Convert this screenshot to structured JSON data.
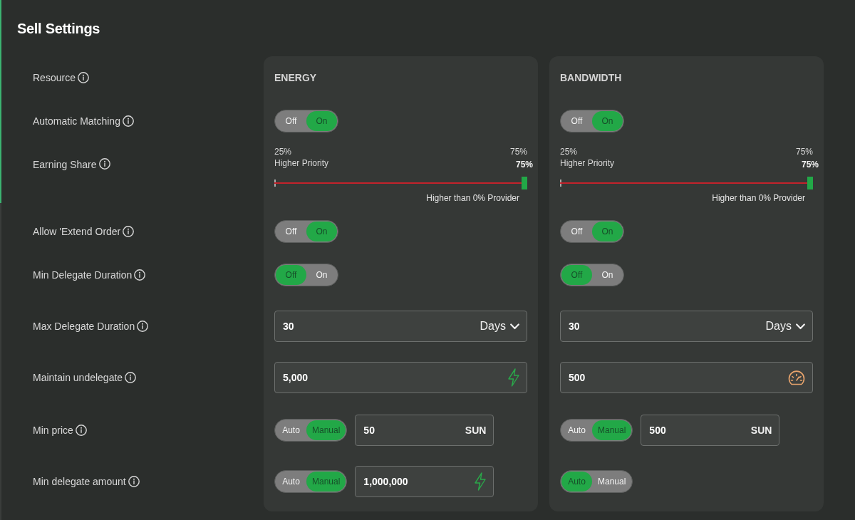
{
  "title": "Sell Settings",
  "setting_labels": [
    "Resource",
    "Automatic Matching",
    "Earning Share",
    "Allow 'Extend Order",
    "Min Delegate Duration",
    "Max Delegate Duration",
    "Maintain undelegate",
    "Min price",
    "Min delegate amount"
  ],
  "resources": [
    {
      "name": "ENERGY",
      "kind": "energy",
      "settings": [
        {
          "kind": "toggle",
          "options": [
            {
              "label": "Off",
              "selected": false
            },
            {
              "label": "On",
              "selected": true
            }
          ]
        },
        {
          "kind": "slider",
          "min_label": "25%",
          "max_label": "75%",
          "caption": "Higher Priority",
          "value_label": "75%",
          "level": 1,
          "note": "Higher than 0% Provider"
        },
        {
          "kind": "toggle",
          "options": [
            {
              "label": "Off",
              "selected": false
            },
            {
              "label": "On",
              "selected": true
            }
          ]
        },
        {
          "kind": "toggle",
          "options": [
            {
              "label": "Off",
              "selected": true
            },
            {
              "label": "On",
              "selected": false
            }
          ]
        },
        {
          "kind": "field",
          "field": {
            "kind": "select",
            "value": "30",
            "unit": "Days"
          }
        },
        {
          "kind": "field",
          "field": {
            "kind": "amount",
            "value": "5,000"
          }
        },
        {
          "kind": "mode",
          "options": [
            {
              "label": "Auto",
              "selected": false
            },
            {
              "label": "Manual",
              "selected": true
            }
          ],
          "field": {
            "kind": "unit",
            "value": "50",
            "unit": "SUN"
          }
        },
        {
          "kind": "mode",
          "options": [
            {
              "label": "Auto",
              "selected": false
            },
            {
              "label": "Manual",
              "selected": true
            }
          ],
          "field": {
            "kind": "amount",
            "value": "1,000,000"
          }
        }
      ]
    },
    {
      "name": "BANDWIDTH",
      "kind": "bandwidth",
      "settings": [
        {
          "kind": "toggle",
          "options": [
            {
              "label": "Off",
              "selected": false
            },
            {
              "label": "On",
              "selected": true
            }
          ]
        },
        {
          "kind": "slider",
          "min_label": "25%",
          "max_label": "75%",
          "caption": "Higher Priority",
          "value_label": "75%",
          "level": 1,
          "note": "Higher than 0% Provider"
        },
        {
          "kind": "toggle",
          "options": [
            {
              "label": "Off",
              "selected": false
            },
            {
              "label": "On",
              "selected": true
            }
          ]
        },
        {
          "kind": "toggle",
          "options": [
            {
              "label": "Off",
              "selected": true
            },
            {
              "label": "On",
              "selected": false
            }
          ]
        },
        {
          "kind": "field",
          "field": {
            "kind": "select",
            "value": "30",
            "unit": "Days"
          }
        },
        {
          "kind": "field",
          "field": {
            "kind": "amount",
            "value": "500"
          }
        },
        {
          "kind": "mode",
          "options": [
            {
              "label": "Auto",
              "selected": false
            },
            {
              "label": "Manual",
              "selected": true
            }
          ],
          "field": {
            "kind": "unit",
            "value": "500",
            "unit": "SUN"
          }
        },
        {
          "kind": "mode",
          "options": [
            {
              "label": "Auto",
              "selected": true
            },
            {
              "label": "Manual",
              "selected": false
            }
          ]
        }
      ]
    }
  ]
}
